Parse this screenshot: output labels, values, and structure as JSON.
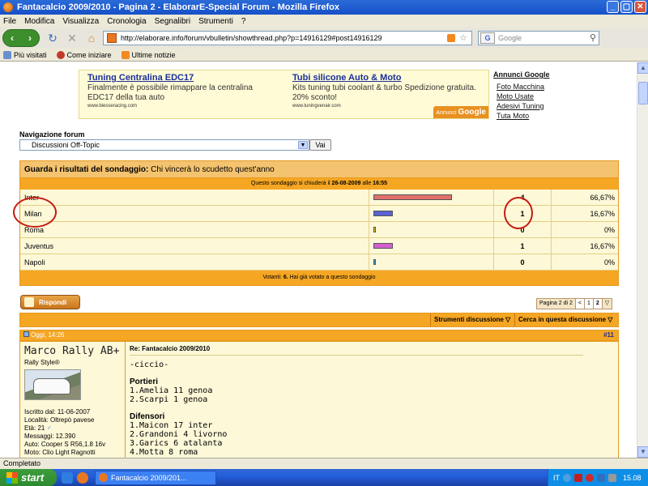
{
  "window": {
    "title": "Fantacalcio 2009/2010 - Pagina 2 - ElaborarE-Special Forum - Mozilla Firefox"
  },
  "menu": [
    "File",
    "Modifica",
    "Visualizza",
    "Cronologia",
    "Segnalibri",
    "Strumenti",
    "?"
  ],
  "url": "http://elaborare.info/forum/vbulletin/showthread.php?p=14916129#post14916129",
  "search": {
    "placeholder": "Google"
  },
  "bookmarks": [
    "Più visitati",
    "Come iniziare",
    "Ultime notizie"
  ],
  "ads": [
    {
      "title": "Tuning Centralina EDC17",
      "desc": "Finalmente è possibile rimappare la centralina EDC17 della tua auto",
      "url": "www.biesseracing.com"
    },
    {
      "title": "Tubi silicone Auto & Moto",
      "desc": "Kits tuning tubi coolant & turbo Spedizione gratuita. 20% sconto!",
      "url": "www.tuningvenair.com"
    }
  ],
  "adsby": {
    "text": "Annunci",
    "brand": "Google"
  },
  "side_ads": {
    "heading": "Annunci Google",
    "links": [
      "Foto Macchina",
      "Moto Usate",
      "Adesivi Tuning",
      "Tuta Moto"
    ]
  },
  "forumnav": {
    "label": "Navigazione forum",
    "selected": "Discussioni Off-Topic",
    "go": "Vai"
  },
  "poll": {
    "head_bold": "Guarda i risultati del sondaggio",
    "question": "Chi vincerà lo scudetto quest'anno",
    "closing_prefix": "Questo sondaggio si chiuderà il",
    "closing_date": "26-08-2009",
    "closing_mid": "alle",
    "closing_time": "16:55",
    "options": [
      {
        "name": "Inter",
        "votes": "4",
        "percent": "66,67%",
        "frac": 0.6667,
        "color": "#e0706a"
      },
      {
        "name": "Milan",
        "votes": "1",
        "percent": "16,67%",
        "frac": 0.1667,
        "color": "#5a63d4"
      },
      {
        "name": "Roma",
        "votes": "0",
        "percent": "0%",
        "frac": 0,
        "color": "#e8c020"
      },
      {
        "name": "Juventus",
        "votes": "1",
        "percent": "16,67%",
        "frac": 0.1667,
        "color": "#d460d0"
      },
      {
        "name": "Napoli",
        "votes": "0",
        "percent": "0%",
        "frac": 0,
        "color": "#3aa0c8"
      }
    ],
    "footer_prefix": "Votanti:",
    "footer_count": "6.",
    "footer_suffix": "Hai già votato a questo sondaggio"
  },
  "rispondi": "Rispondi",
  "pager": {
    "label": "Pagina 2 di 2",
    "prev": "<",
    "p1": "1",
    "p2": "2"
  },
  "tools": {
    "t1": "Strumenti discussione",
    "t2": "Cerca in questa discussione"
  },
  "post": {
    "date": "Oggi, 14:26",
    "number": "#11",
    "user": "Marco Rally AB+",
    "user_title": "Rally Style®",
    "info": [
      "Iscritto dal: 11-06-2007",
      "Località: Oltrepò pavese",
      "Età: 21",
      "Messaggi: 12.390",
      "Auto: Cooper S R56,1.8 16v",
      "Moto: Clio Light Ragnotti"
    ],
    "title": "Re: Fantacalcio 2009/2010",
    "lines": [
      "-ciccio-"
    ],
    "section1": "Portieri",
    "portieri": [
      "1.Amelia 11 genoa",
      "2.Scarpi 1 genoa"
    ],
    "section2": "Difensori",
    "difensori": [
      "1.Maicon 17 inter",
      "2.Grandoni 4 livorno",
      "3.Garics 6 atalanta",
      "4.Motta 8 roma"
    ]
  },
  "status": "Completato",
  "taskbar": {
    "start": "start",
    "item": "Fantacalcio 2009/201...",
    "lang": "IT",
    "clock": "15.08"
  }
}
